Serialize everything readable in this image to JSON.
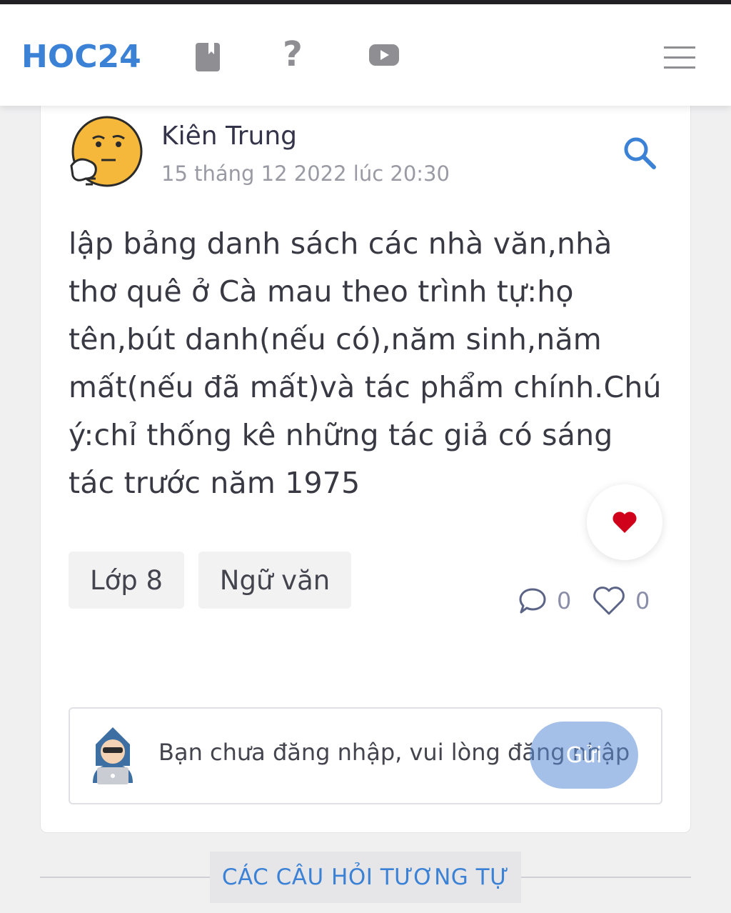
{
  "header": {
    "logo": "HOC24",
    "icons": [
      "book-icon",
      "question-icon",
      "video-icon",
      "menu-icon"
    ],
    "question_glyph": "?"
  },
  "post": {
    "author": "Kiên Trung",
    "date": "15 tháng 12 2022 lúc 20:30",
    "content": "lập bảng danh sách các nhà văn,nhà thơ quê ở Cà mau theo trình tự:họ tên,bút danh(nếu có),năm sinh,năm mất(nếu đã mất)và tác phẩm chính.Chú ý:chỉ thống kê những tác giả có sáng tác trước năm 1975",
    "tags": [
      "Lớp 8",
      "Ngữ văn"
    ],
    "comments_count": "0",
    "likes_count": "0"
  },
  "comment_box": {
    "prompt": "Bạn chưa đăng nhập, vui lòng đăng nhập",
    "send_label": "Gửi"
  },
  "related": {
    "title": "CÁC CÂU HỎI TƯƠNG TỰ"
  },
  "colors": {
    "brand": "#3b82d6",
    "heart": "#d0021b",
    "background": "#f0f0f1"
  }
}
